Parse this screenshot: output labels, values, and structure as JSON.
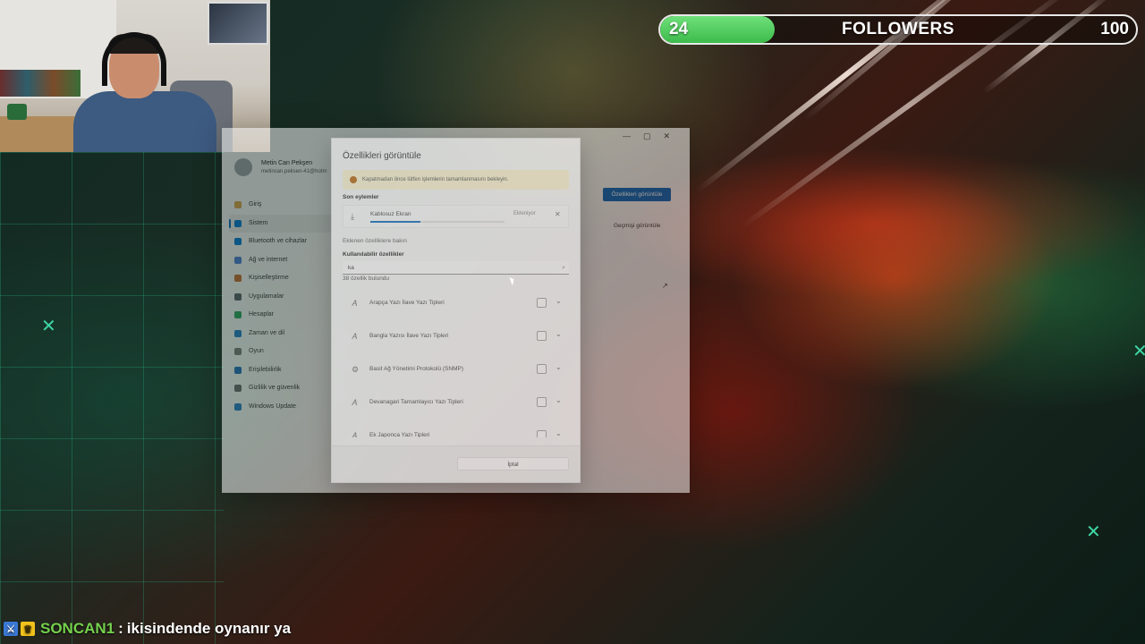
{
  "overlay": {
    "followers": {
      "current": "24",
      "label": "FOLLOWERS",
      "goal": "100",
      "progress_fraction": 0.24
    },
    "chat": {
      "username": "SONCAN1",
      "separator": ":",
      "message": "ikisindende oynanır ya"
    }
  },
  "settings_window": {
    "profile": {
      "name": "Metin Can Pekşen",
      "email": "metincan.peksen-41@hotm"
    },
    "nav": [
      {
        "label": "Giriş",
        "icon": "home-icon",
        "color": "#d8a14a"
      },
      {
        "label": "Sistem",
        "icon": "system-icon",
        "color": "#0078d4",
        "active": true
      },
      {
        "label": "Bluetooth ve cihazlar",
        "icon": "bluetooth-icon",
        "color": "#0078d4"
      },
      {
        "label": "Ağ ve internet",
        "icon": "wifi-icon",
        "color": "#4a7bd0"
      },
      {
        "label": "Kişiselleştirme",
        "icon": "brush-icon",
        "color": "#c46a2d"
      },
      {
        "label": "Uygulamalar",
        "icon": "apps-icon",
        "color": "#555c66"
      },
      {
        "label": "Hesaplar",
        "icon": "person-icon",
        "color": "#2aa05a"
      },
      {
        "label": "Zaman ve dil",
        "icon": "clock-globe-icon",
        "color": "#1f7ac4"
      },
      {
        "label": "Oyun",
        "icon": "gamepad-icon",
        "color": "#777777"
      },
      {
        "label": "Erişilebilirlik",
        "icon": "accessibility-icon",
        "color": "#1f6bb8"
      },
      {
        "label": "Gizlilik ve güvenlik",
        "icon": "shield-icon",
        "color": "#666666"
      },
      {
        "label": "Windows Update",
        "icon": "update-icon",
        "color": "#1f7ac4"
      }
    ],
    "view_features_button": "Özellikleri görüntüle",
    "view_history_button": "Geçmişi görüntüle"
  },
  "dialog": {
    "title": "Özellikleri görüntüle",
    "warning": "Kapatmadan önce lütfen işlemlerin tamamlanmasını bekleyin.",
    "recent_actions_label": "Son eylemler",
    "recent_item": {
      "name": "Kablosuz Ekran",
      "status": "Ekleniyor",
      "progress_fraction": 0.37
    },
    "see_added_link": "Eklenen özelliklere bakın",
    "available_label": "Kullanılabilir özellikler",
    "search_value": "ka",
    "found_count": "38 özellik bulundu",
    "features": [
      {
        "name": "Arapça Yazı İlave Yazı Tipleri",
        "icon": "font-icon"
      },
      {
        "name": "Bangla Yazısı İlave Yazı Tipleri",
        "icon": "font-icon"
      },
      {
        "name": "Basit Ağ Yönetimi Protokolü (SNMP)",
        "icon": "gear-icon"
      },
      {
        "name": "Devanagari Tamamlayıcı Yazı Tipleri",
        "icon": "font-icon"
      },
      {
        "name": "Ek Japonca Yazı Tipleri",
        "icon": "font-icon"
      }
    ],
    "cancel_button": "İptal"
  }
}
